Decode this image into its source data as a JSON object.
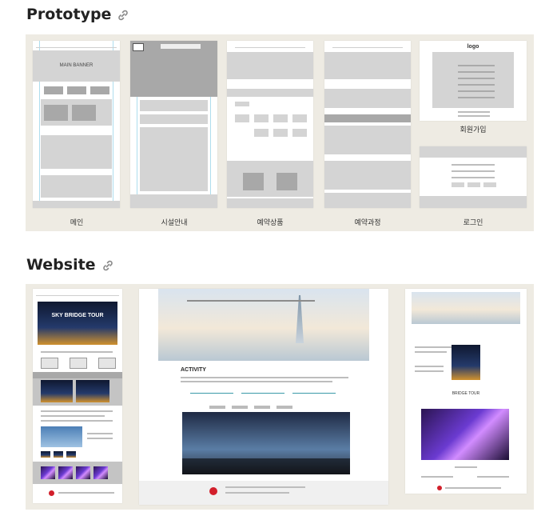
{
  "sections": {
    "prototype_title": "Prototype",
    "website_title": "Website"
  },
  "prototype": {
    "captions": [
      "메인",
      "시설안내",
      "예약상품",
      "예약과정",
      "로그인"
    ],
    "signup_caption": "회원가입",
    "main": {
      "banner": "MAIN BANNER"
    },
    "login": {
      "logo": "logo"
    }
  },
  "website": {
    "activity_title": "ACTIVITY",
    "sky_bridge": "SKY BRIDGE TOUR",
    "sky_bridge_tour": "BRIDGE TOUR"
  },
  "colors": {
    "panel_bg": "#eeebe3",
    "wire_gray": "#d4d4d4",
    "guide_blue": "#9ad4ea",
    "brand_red": "#d21f2b"
  },
  "icons": {
    "heading_link": "link-icon"
  }
}
